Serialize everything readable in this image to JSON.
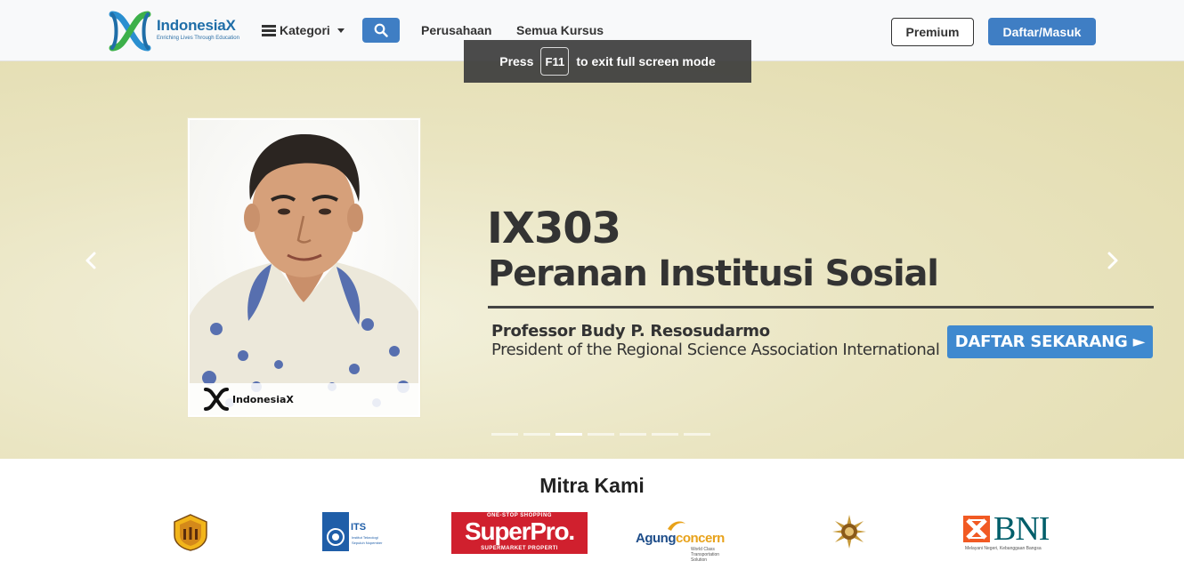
{
  "navbar": {
    "brand": "IndonesiaX",
    "tagline": "Enriching Lives Through Education",
    "kategori_label": "Kategori",
    "links": [
      "Perusahaan",
      "Semua Kursus"
    ],
    "premium_label": "Premium",
    "daftar_label": "Daftar/Masuk"
  },
  "toast": {
    "prefix": "Press",
    "key": "F11",
    "suffix": "to exit full screen mode"
  },
  "hero": {
    "course_code": "IX303",
    "course_name": "Peranan Institusi Sosial",
    "professor": "Professor Budy P. Resosudarmo",
    "professor_title": "President of the Regional Science Association International",
    "cta_label": "DAFTAR SEKARANG ►",
    "portrait_brand": "IndonesiaX",
    "slide_count": 7,
    "active_slide": 2
  },
  "mitra": {
    "title": "Mitra Kami",
    "partners": [
      {
        "name": "universitas-padjadjaran"
      },
      {
        "name": "its",
        "text": "ITS",
        "sub": "Institut Teknologi Sepuluh Nopember"
      },
      {
        "name": "superpro",
        "top": "ONE-STOP SHOPPING",
        "text": "SuperPro.",
        "sub": "SUPERMARKET PROPERTI"
      },
      {
        "name": "agung-concern",
        "text_a": "Agung",
        "text_b": "concern",
        "sub": "World Class Transportation Solution"
      },
      {
        "name": "universitas-gadjah-mada"
      },
      {
        "name": "bni",
        "text": "BNI",
        "sub": "Melayani Negeri, Kebanggaan Bangsa"
      }
    ]
  },
  "colors": {
    "primary": "#3f7ec4",
    "cta": "#3f89cf",
    "hero_bg": "#e8e2bb",
    "superpro_red": "#d0202e",
    "bni_orange": "#f15a23",
    "bni_teal": "#005e6a"
  }
}
